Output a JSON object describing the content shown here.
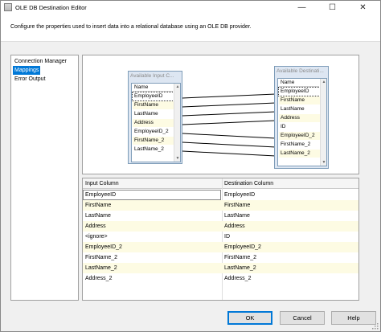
{
  "window": {
    "title": "OLE DB Destination Editor",
    "buttons": {
      "minimize": "—",
      "maximize": "☐",
      "close": "✕"
    }
  },
  "description": "Configure the properties used to insert data into a relational database using an OLE DB provider.",
  "nav": {
    "items": [
      {
        "label": "Connection Manager",
        "selected": false
      },
      {
        "label": "Mappings",
        "selected": true
      },
      {
        "label": "Error Output",
        "selected": false
      }
    ]
  },
  "input_box": {
    "title": "Available Input C...",
    "header": "Name",
    "columns": [
      "EmployeeID",
      "FirstName",
      "LastName",
      "Address",
      "EmployeeID_2",
      "FirstName_2",
      "LastName_2"
    ]
  },
  "dest_box": {
    "title": "Available Destinati...",
    "header": "Name",
    "columns": [
      "EmployeeID",
      "FirstName",
      "LastName",
      "Address",
      "ID",
      "EmployeeID_2",
      "FirstName_2",
      "LastName_2"
    ]
  },
  "grid": {
    "headers": {
      "input": "Input Column",
      "destination": "Destination Column"
    },
    "rows": [
      {
        "input": "EmployeeID",
        "destination": "EmployeeID"
      },
      {
        "input": "FirstName",
        "destination": "FirstName"
      },
      {
        "input": "LastName",
        "destination": "LastName"
      },
      {
        "input": "Address",
        "destination": "Address"
      },
      {
        "input": "<ignore>",
        "destination": "ID"
      },
      {
        "input": "EmployeeID_2",
        "destination": "EmployeeID_2"
      },
      {
        "input": "FirstName_2",
        "destination": "FirstName_2"
      },
      {
        "input": "LastName_2",
        "destination": "LastName_2"
      },
      {
        "input": "Address_2",
        "destination": "Address_2"
      }
    ]
  },
  "footer": {
    "ok": "OK",
    "cancel": "Cancel",
    "help": "Help"
  },
  "icons": [
    "app-icon",
    "minimize-icon",
    "maximize-icon",
    "close-icon",
    "scroll-up-icon",
    "scroll-down-icon",
    "resize-grip-icon"
  ]
}
